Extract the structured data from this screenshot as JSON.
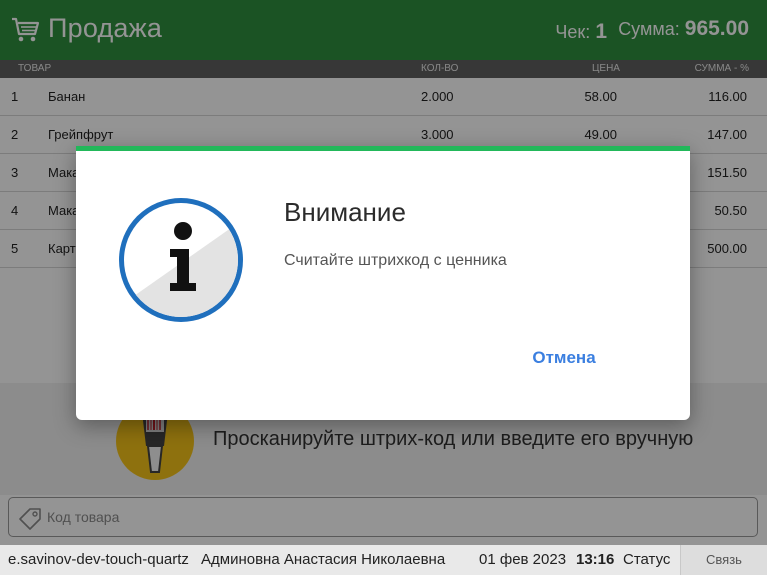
{
  "header": {
    "title": "Продажа",
    "check_label": "Чек:",
    "check_number": "1",
    "sum_label": "Сумма:",
    "sum_value": "965.00",
    "icon": "cart-icon"
  },
  "table": {
    "columns": [
      "ТОВАР",
      "КОЛ-ВО",
      "ЦЕНА",
      "СУММА - %"
    ],
    "rows": [
      {
        "num": "1",
        "name": "Банан",
        "qty": "2.000",
        "price": "58.00",
        "sum": "116.00"
      },
      {
        "num": "2",
        "name": "Грейпфрут",
        "qty": "3.000",
        "price": "49.00",
        "sum": "147.00"
      },
      {
        "num": "3",
        "name": "Мака",
        "qty": "",
        "price": "",
        "sum": "151.50"
      },
      {
        "num": "4",
        "name": "Мака",
        "qty": "",
        "price": "",
        "sum": "50.50"
      },
      {
        "num": "5",
        "name": "Карт",
        "qty": "",
        "price": "",
        "sum": "500.00"
      }
    ]
  },
  "scan": {
    "prompt": "Просканируйте штрих-код или введите его вручную",
    "icon": "barcode-scanner-icon"
  },
  "input": {
    "placeholder": "Код товара",
    "value": "",
    "icon": "tag-icon"
  },
  "status_bar": {
    "device": "e.savinov-dev-touch-quartz",
    "user": "Админовна Анастасия Николаевна",
    "date": "01 фев 2023",
    "time": "13:16",
    "status": "Статус",
    "link_button": "Связь"
  },
  "dialog": {
    "title": "Внимание",
    "message": "Считайте штрихкод с ценника",
    "cancel": "Отмена",
    "icon": "info-icon",
    "accent": "#22b85a"
  },
  "colors": {
    "header_bg": "#2f8f3f",
    "link_blue": "#3b7fe0",
    "scanner_yellow": "#f5c319"
  }
}
